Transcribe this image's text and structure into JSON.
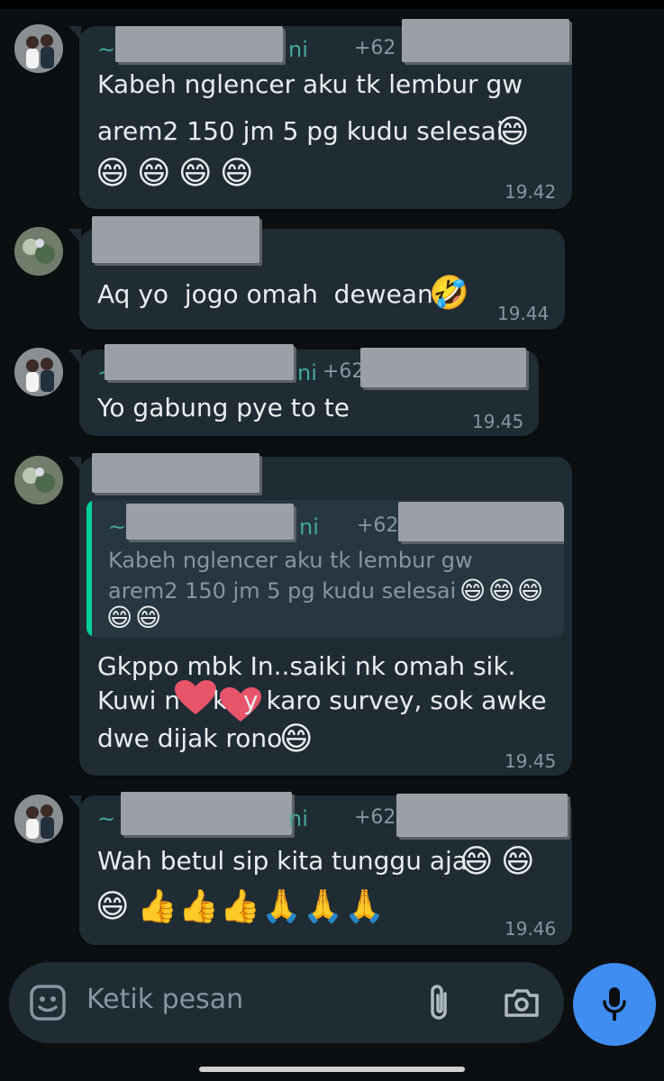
{
  "messages": [
    {
      "id": "m1",
      "sender_prefix": "~",
      "sender_suffix": "ni",
      "phone_prefix": "+62 8",
      "lines": [
        "Kabeh nglencer aku tk lembur gw",
        "arem2 150 jm 5 pg kudu selesai"
      ],
      "emojis": [
        "grin",
        "grin",
        "grin",
        "grin",
        "grin"
      ],
      "time": "19.42"
    },
    {
      "id": "m2",
      "lines": [
        "Aq yo  jogo omah  dewean"
      ],
      "emojis": [
        "rofl"
      ],
      "time": "19.44"
    },
    {
      "id": "m3",
      "sender_prefix": "~",
      "sender_suffix": "ni",
      "phone_prefix": "+62",
      "lines": [
        "Yo gabung pye to te"
      ],
      "time": "19.45"
    },
    {
      "id": "m4",
      "quote": {
        "sender_prefix": "~",
        "sender_suffix": "ni",
        "phone_prefix": "+62",
        "lines": [
          "Kabeh nglencer aku tk lembur gw",
          "arem2 150 jm 5 pg kudu selesai"
        ],
        "emojis": [
          "grin",
          "grin",
          "grin",
          "grin",
          "grin"
        ]
      },
      "lines": [
        "Gkppo mbk In..saiki nk omah sik.",
        "Kuwi n",
        "k",
        "y karo survey, sok awke",
        "dwe dijak rono"
      ],
      "emojis": [
        "grin",
        "heart",
        "heart"
      ],
      "time": "19.45"
    },
    {
      "id": "m5",
      "sender_prefix": "~ I",
      "sender_suffix": "ni",
      "phone_prefix": "+62",
      "lines": [
        "Wah betul sip kita tunggu aja"
      ],
      "emojis": [
        "grin",
        "grin",
        "grin",
        "thumbs-up",
        "thumbs-up",
        "thumbs-up",
        "folded-hands",
        "folded-hands",
        "folded-hands"
      ],
      "time": "19.46"
    }
  ],
  "composer": {
    "placeholder": "Ketik pesan",
    "icons": [
      "sticker-icon",
      "attach-icon",
      "camera-icon",
      "mic-icon"
    ]
  },
  "emoji_glyphs": {
    "grin": "😄",
    "rofl": "🤣",
    "thumbs-up": "👍",
    "folded-hands": "🙏"
  },
  "colors": {
    "background": "#0b0f12",
    "bubble": "#1f2c34",
    "sender_name": "#53bdeb",
    "time": "#8696a0",
    "quote_bar": "#06cf9c",
    "mic_button": "#3f8df0",
    "heart": "#e8546a"
  }
}
